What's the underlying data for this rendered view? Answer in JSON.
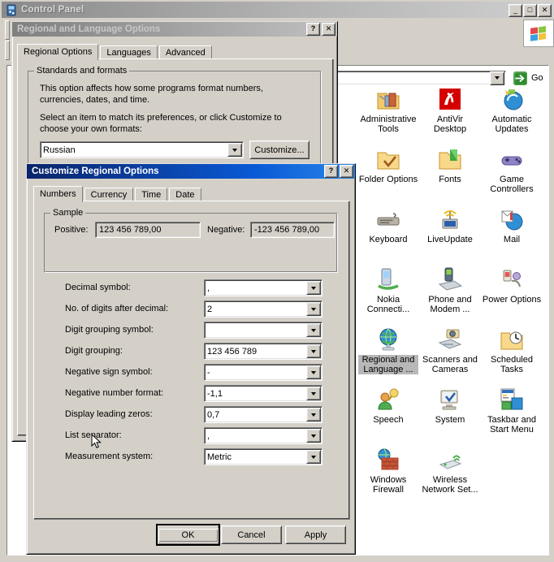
{
  "control_panel": {
    "title": "Control Panel",
    "window_buttons": {
      "minimize": "_",
      "maximize": "□",
      "close": "✕"
    },
    "address": {
      "value": "",
      "placeholder": ""
    },
    "go_label": "Go",
    "icons": [
      {
        "label": "Administrative Tools",
        "icon": "admin-tools-icon",
        "selected": false
      },
      {
        "label": "AntiVir Desktop",
        "icon": "antivir-icon",
        "selected": false
      },
      {
        "label": "Automatic Updates",
        "icon": "automatic-updates-icon",
        "selected": false
      },
      {
        "label": "Folder Options",
        "icon": "folder-options-icon",
        "selected": false
      },
      {
        "label": "Fonts",
        "icon": "fonts-icon",
        "selected": false
      },
      {
        "label": "Game Controllers",
        "icon": "game-controllers-icon",
        "selected": false
      },
      {
        "label": "Keyboard",
        "icon": "keyboard-icon",
        "selected": false
      },
      {
        "label": "LiveUpdate",
        "icon": "liveupdate-icon",
        "selected": false
      },
      {
        "label": "Mail",
        "icon": "mail-icon",
        "selected": false
      },
      {
        "label": "Nokia Connecti...",
        "icon": "nokia-connect-icon",
        "selected": false
      },
      {
        "label": "Phone and Modem ...",
        "icon": "phone-modem-icon",
        "selected": false
      },
      {
        "label": "Power Options",
        "icon": "power-options-icon",
        "selected": false
      },
      {
        "label": "Regional and Language ...",
        "icon": "regional-language-icon",
        "selected": true
      },
      {
        "label": "Scanners and Cameras",
        "icon": "scanners-cameras-icon",
        "selected": false
      },
      {
        "label": "Scheduled Tasks",
        "icon": "scheduled-tasks-icon",
        "selected": false
      },
      {
        "label": "Speech",
        "icon": "speech-icon",
        "selected": false
      },
      {
        "label": "System",
        "icon": "system-icon",
        "selected": false
      },
      {
        "label": "Taskbar and Start Menu",
        "icon": "taskbar-start-icon",
        "selected": false
      },
      {
        "label": "Windows Firewall",
        "icon": "windows-firewall-icon",
        "selected": false
      },
      {
        "label": "Wireless Network Set...",
        "icon": "wireless-network-icon",
        "selected": false
      }
    ]
  },
  "regional_dialog": {
    "title": "Regional and Language Options",
    "help_btn": "?",
    "close_btn": "✕",
    "tabs": [
      {
        "label": "Regional Options",
        "active": true
      },
      {
        "label": "Languages",
        "active": false
      },
      {
        "label": "Advanced",
        "active": false
      }
    ],
    "group_legend": "Standards and formats",
    "description_1": "This option affects how some programs format numbers, currencies, dates, and time.",
    "description_2": "Select an item to match its preferences, or click Customize to choose your own formats:",
    "locale_value": "Russian",
    "customize_button": "Customize..."
  },
  "customize_dialog": {
    "title": "Customize Regional Options",
    "help_btn": "?",
    "close_btn": "✕",
    "tabs": [
      {
        "label": "Numbers",
        "active": true
      },
      {
        "label": "Currency",
        "active": false
      },
      {
        "label": "Time",
        "active": false
      },
      {
        "label": "Date",
        "active": false
      }
    ],
    "sample": {
      "legend": "Sample",
      "positive_label": "Positive:",
      "positive_value": "123 456 789,00",
      "negative_label": "Negative:",
      "negative_value": "-123 456 789,00"
    },
    "fields": [
      {
        "label": "Decimal symbol:",
        "value": ",",
        "focused": true
      },
      {
        "label": "No. of digits after decimal:",
        "value": "2",
        "focused": false
      },
      {
        "label": "Digit grouping symbol:",
        "value": "",
        "focused": false
      },
      {
        "label": "Digit grouping:",
        "value": "123 456 789",
        "focused": false
      },
      {
        "label": "Negative sign symbol:",
        "value": "-",
        "focused": false
      },
      {
        "label": "Negative number format:",
        "value": "-1,1",
        "focused": false
      },
      {
        "label": "Display leading zeros:",
        "value": "0,7",
        "focused": false
      },
      {
        "label": "List separator:",
        "value": ",",
        "focused": false
      },
      {
        "label": "Measurement system:",
        "value": "Metric",
        "focused": false
      }
    ],
    "buttons": {
      "ok": "OK",
      "cancel": "Cancel",
      "apply": "Apply"
    }
  },
  "colors": {
    "desktop_face": "#d4d0c8",
    "active_title": "#0a246a",
    "inactive_title": "#808080",
    "selection": "#b8b8b8",
    "go_green": "#2f8b2f"
  }
}
